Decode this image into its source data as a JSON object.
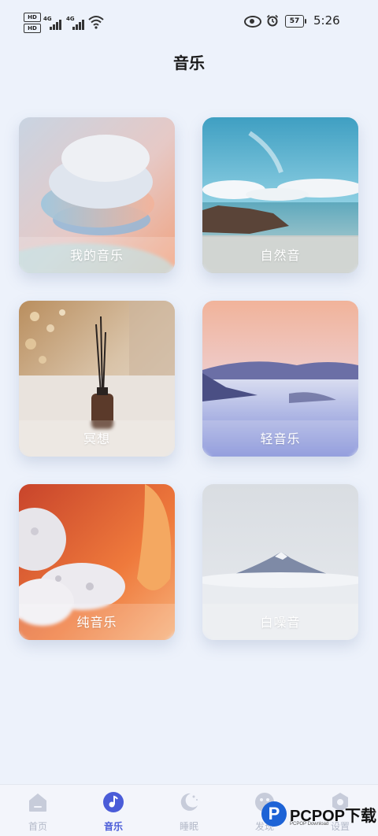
{
  "status_bar": {
    "hd1": "HD",
    "hd2": "HD",
    "net1": "4G",
    "net2": "4G",
    "battery": "57",
    "time": "5:26"
  },
  "page": {
    "title": "音乐"
  },
  "cards": [
    {
      "label": "我的音乐"
    },
    {
      "label": "自然音"
    },
    {
      "label": "冥想"
    },
    {
      "label": "轻音乐"
    },
    {
      "label": "纯音乐"
    },
    {
      "label": "白噪音"
    }
  ],
  "tabs": [
    {
      "label": "首页",
      "icon": "home-icon",
      "active": false
    },
    {
      "label": "音乐",
      "icon": "music-note-icon",
      "active": true
    },
    {
      "label": "睡眠",
      "icon": "moon-icon",
      "active": false
    },
    {
      "label": "发现",
      "icon": "discover-icon",
      "active": false
    },
    {
      "label": "设置",
      "icon": "gear-icon",
      "active": false
    }
  ],
  "colors": {
    "accent": "#4a5cd8",
    "tab_inactive": "#b3b9c8",
    "background": "#edf2fb"
  },
  "watermark": {
    "brand": "PCPOP下载",
    "sub": "PCPOP Download"
  }
}
